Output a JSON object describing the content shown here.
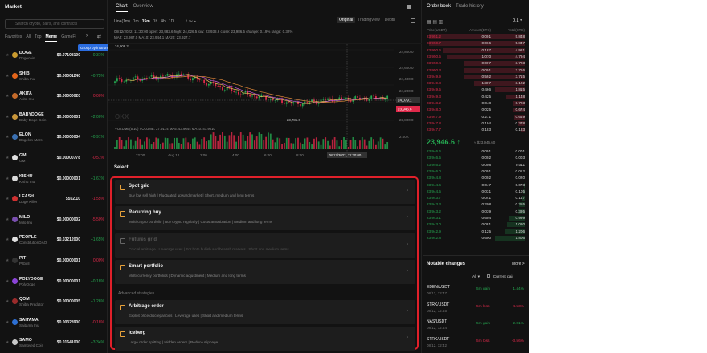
{
  "market": {
    "title": "Market",
    "search_placeholder": "Search crypto, pairs, and contracts",
    "tabs": [
      "Favorites",
      "All",
      "Top",
      "Meme",
      "GameFi"
    ],
    "active_tab": "Meme",
    "tooltip": "Group by instrument",
    "coins": [
      {
        "sym": "DOGE",
        "name": "Dogecoin",
        "price": "$0.07108100",
        "change": "+0.31%",
        "dir": "up",
        "color": "#c99a2e"
      },
      {
        "sym": "SHIB",
        "name": "Shiba Inu",
        "price": "$0.00001240",
        "change": "+0.75%",
        "dir": "up",
        "color": "#e2641a"
      },
      {
        "sym": "AKITA",
        "name": "Akita Inu",
        "price": "$0.00000020",
        "change": "0.00%",
        "dir": "down",
        "color": "#c46a2a"
      },
      {
        "sym": "BABYDOGE",
        "name": "Baby Doge Coin",
        "price": "$0.00000001",
        "change": "+2.00%",
        "dir": "up",
        "color": "#c9963a"
      },
      {
        "sym": "ELON",
        "name": "Dogelon Mars",
        "price": "$0.00000034",
        "change": "+0.91%",
        "dir": "up",
        "color": "#3a6fb0"
      },
      {
        "sym": "GM",
        "name": "GM",
        "price": "$0.00000778",
        "change": "-0.51%",
        "dir": "down",
        "color": "#e0e0e0"
      },
      {
        "sym": "KISHU",
        "name": "Kishu Inu",
        "price": "$0.00000001",
        "change": "+1.61%",
        "dir": "up",
        "color": "#d9d9d9"
      },
      {
        "sym": "LEASH",
        "name": "Doge Killer",
        "price": "$592.10",
        "change": "-1.55%",
        "dir": "down",
        "color": "#d03030"
      },
      {
        "sym": "MILO",
        "name": "Milo Inu",
        "price": "$0.00000002",
        "change": "-5.50%",
        "dir": "down",
        "color": "#7a4fb0"
      },
      {
        "sym": "PEOPLE",
        "name": "ConstitutionDAO",
        "price": "$0.03212000",
        "change": "+1.65%",
        "dir": "up",
        "color": "#e0e0e0"
      },
      {
        "sym": "PIT",
        "name": "Pitbull",
        "price": "$0.00000001",
        "change": "0.00%",
        "dir": "down",
        "color": "#333"
      },
      {
        "sym": "POLYDOGE",
        "name": "PolyDoge",
        "price": "$0.00000001",
        "change": "+0.18%",
        "dir": "up",
        "color": "#8b44d8"
      },
      {
        "sym": "QOM",
        "name": "Shiba Predator",
        "price": "$0.00000005",
        "change": "+1.26%",
        "dir": "up",
        "color": "#9a2b2b"
      },
      {
        "sym": "SAITAMA",
        "name": "Saitama Inu",
        "price": "$0.00328900",
        "change": "-0.18%",
        "dir": "down",
        "color": "#2d6fd3"
      },
      {
        "sym": "SAMO",
        "name": "Samoyed Coin",
        "price": "$0.01641000",
        "change": "+3.34%",
        "dir": "up",
        "color": "#c9c9c9"
      }
    ]
  },
  "chart": {
    "tabs": [
      "Chart",
      "Overview"
    ],
    "active_tab": "Chart",
    "intervals": [
      "Line(1m)",
      "1m",
      "15m",
      "1h",
      "4h",
      "1D"
    ],
    "active_interval": "15m",
    "views": [
      "Original",
      "TradingView",
      "Depth"
    ],
    "active_view": "Original",
    "ohlc": "08/12/2022, 11:30:00  open: 23,982.6  high: 24,026.5  low: 23,938.6  close: 23,986.5  change: 0.19%  range: 0.32%",
    "ma_line": "MA5: 23,987.0   MA10: 23,944.1   MA20: 23,927.7",
    "last_price_tag": "23,946.6",
    "cursor_price_tag": "24,079.1",
    "high_label": "24,908.2",
    "low_label": "23,785.6",
    "price_ticks": [
      "24,800.0",
      "24,600.0",
      "24,400.0",
      "24,200.0",
      "23,800.0"
    ],
    "volume_line": "VOLUME(5,10)  VOLUME: 27.9174  MA5: 43.9644  MA10: 47.9010",
    "volume_ticks": [
      "2.00K"
    ],
    "time_ticks": [
      "22:00",
      "Aug 12",
      "2:00",
      "4:00",
      "6:00",
      "8:00",
      "10:00"
    ],
    "cursor_time": "08/12/2022, 11:30:00",
    "watermark": "OKX"
  },
  "strategies": {
    "title": "Select",
    "advanced_label": "Advanced strategies",
    "items": [
      {
        "title": "Spot grid",
        "desc": "Buy low sell high  |  Fluctuated upward market  |  Short, medium and long terms",
        "disabled": false
      },
      {
        "title": "Recurring buy",
        "desc": "Multi-crypto portfolio  |  Buy crypto regularly  |  Costs amortization  |  Medium and long terms",
        "disabled": false
      },
      {
        "title": "Futures grid",
        "desc": "Crucial arbitrage  |  Leverage uses  |  For both bullish and bearish markets  |  Short and medium terms",
        "disabled": true
      },
      {
        "title": "Smart portfolio",
        "desc": "Multi-currency portfolios  |  Dynamic adjustment  |  Medium and long terms",
        "disabled": false
      },
      {
        "title": "Arbitrage order",
        "desc": "Exploit price discrepancies  |  Leverage uses  |  Short and medium terms",
        "disabled": false
      },
      {
        "title": "Iceberg",
        "desc": "Large order splitting  |  Hidden orders  |  Reduce slippage",
        "disabled": false
      }
    ]
  },
  "orderbook": {
    "tabs": [
      "Order book",
      "Trade history"
    ],
    "active_tab": "Order book",
    "step": "0.1",
    "headers": [
      "Price(USDT)",
      "Amount(BTC)",
      "Total(BTC)"
    ],
    "asks": [
      [
        "23,951.2",
        "0.001",
        "5.848"
      ],
      [
        "23,950.7",
        "0.066",
        "5.847"
      ],
      [
        "23,950.6",
        "0.187",
        "4.981"
      ],
      [
        "23,950.5",
        "1.070",
        "4.794"
      ],
      [
        "23,950.4",
        "0.007",
        "3.723"
      ],
      [
        "23,950.3",
        "0.001",
        "3.716"
      ],
      [
        "23,949.9",
        "0.592",
        "3.715"
      ],
      [
        "23,949.8",
        "1.307",
        "3.122"
      ],
      [
        "23,949.5",
        "0.466",
        "1.815"
      ],
      [
        "23,949.3",
        "0.425",
        "1.148"
      ],
      [
        "23,948.2",
        "0.048",
        "0.723"
      ],
      [
        "23,948.0",
        "0.025",
        "0.674"
      ],
      [
        "23,947.9",
        "0.271",
        "0.649"
      ],
      [
        "23,947.8",
        "0.194",
        "0.378"
      ],
      [
        "23,947.7",
        "0.183",
        "0.183"
      ]
    ],
    "mid_price": "23,946.6 ↑",
    "mid_usd": "≈ $23,946.60",
    "bids": [
      [
        "23,946.6",
        "0.001",
        "0.001"
      ],
      [
        "23,946.5",
        "0.002",
        "0.003"
      ],
      [
        "23,946.2",
        "0.008",
        "0.011"
      ],
      [
        "23,946.0",
        "0.001",
        "0.012"
      ],
      [
        "23,944.8",
        "0.002",
        "0.020"
      ],
      [
        "23,944.6",
        "0.047",
        "0.073"
      ],
      [
        "23,944.5",
        "0.031",
        "0.105"
      ],
      [
        "23,943.7",
        "0.041",
        "0.147"
      ],
      [
        "23,943.3",
        "0.208",
        "0.355"
      ],
      [
        "23,943.2",
        "0.039",
        "0.395"
      ],
      [
        "23,943.1",
        "0.604",
        "0.999"
      ],
      [
        "23,943.0",
        "0.081",
        "1.080"
      ],
      [
        "23,942.9",
        "0.125",
        "1.206"
      ],
      [
        "23,942.8",
        "0.600",
        "1.806"
      ]
    ]
  },
  "notable": {
    "title": "Notable changes",
    "more": "More >",
    "filter": "All ▾",
    "checkbox": "Current pair",
    "items": [
      {
        "pair": "EDEN/USDT",
        "time": "08/12, 12:47",
        "kind": "5m gain",
        "value": "1.44%",
        "dir": "up"
      },
      {
        "pair": "STRK/USDT",
        "time": "08/12, 12:45",
        "kind": "5m loss",
        "value": "-4.53%",
        "dir": "down"
      },
      {
        "pair": "NAS/USDT",
        "time": "08/12, 12:44",
        "kind": "5m gain",
        "value": "2.01%",
        "dir": "up"
      },
      {
        "pair": "STRK/USDT",
        "time": "08/12, 12:42",
        "kind": "5m loss",
        "value": "-3.56%",
        "dir": "down"
      }
    ]
  }
}
